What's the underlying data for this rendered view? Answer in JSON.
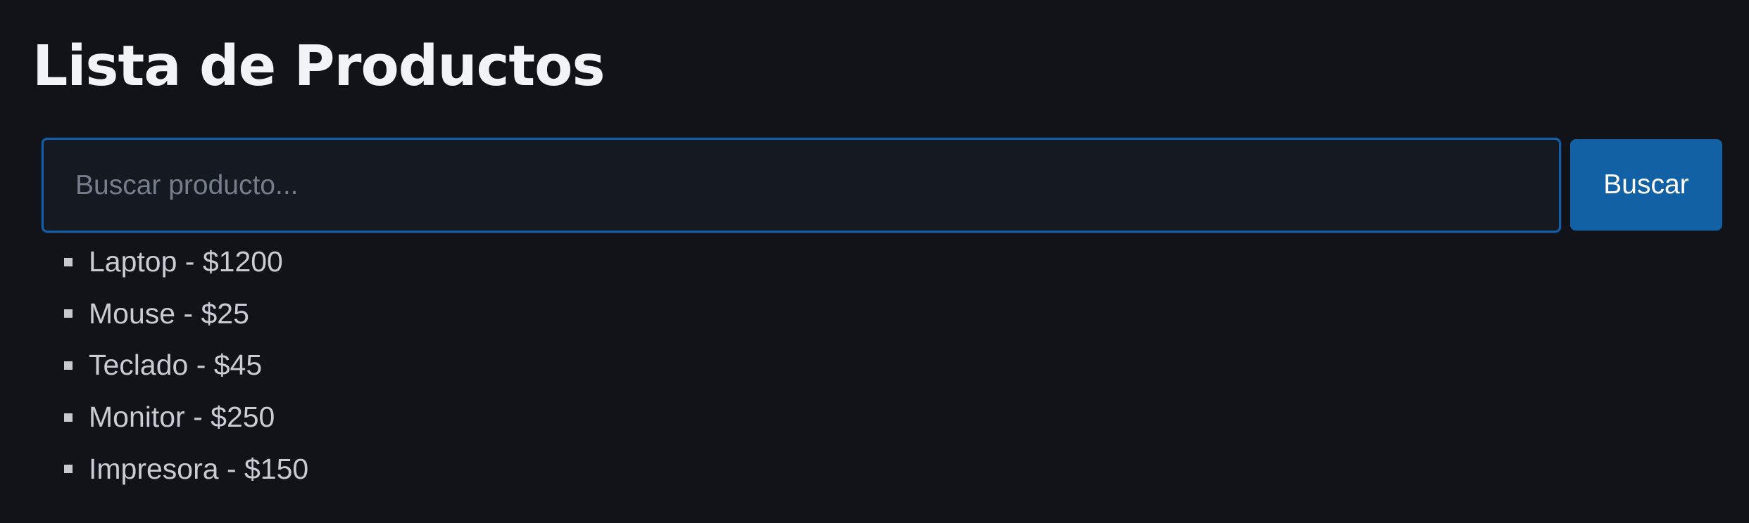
{
  "page": {
    "title": "Lista de Productos"
  },
  "search": {
    "placeholder": "Buscar producto...",
    "value": "",
    "button_label": "Buscar"
  },
  "products": {
    "items": [
      {
        "label": "Laptop - $1200"
      },
      {
        "label": "Mouse - $25"
      },
      {
        "label": "Teclado - $45"
      },
      {
        "label": "Monitor - $250"
      },
      {
        "label": "Impresora - $150"
      }
    ]
  },
  "colors": {
    "background": "#111318",
    "input_background": "#151922",
    "input_border": "#145ea8",
    "button_background": "#1261a5",
    "text_primary": "#f2f3f6",
    "text_secondary": "#c9ccd3",
    "placeholder": "#777d8a"
  },
  "icons": {
    "list_bullet": "square-bullet-icon"
  }
}
